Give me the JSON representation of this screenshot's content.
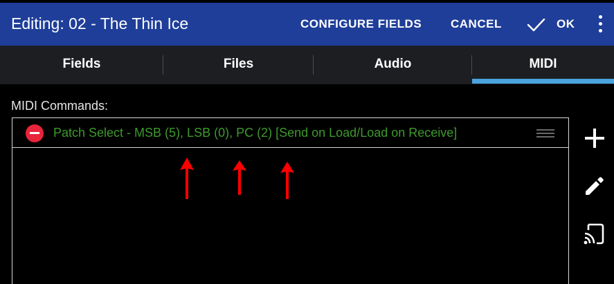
{
  "header": {
    "title": "Editing: 02 - The Thin Ice",
    "configure_label": "CONFIGURE FIELDS",
    "cancel_label": "CANCEL",
    "ok_label": "OK",
    "background_color": "#1f3e99"
  },
  "tabs": [
    {
      "label": "Fields",
      "active": false
    },
    {
      "label": "Files",
      "active": false
    },
    {
      "label": "Audio",
      "active": false
    },
    {
      "label": "MIDI",
      "active": true
    }
  ],
  "tab_indicator_color": "#4aa3de",
  "midi": {
    "section_label": "MIDI Commands:",
    "commands": [
      {
        "text": "Patch Select - MSB (5), LSB (0), PC (2) [Send on Load/Load on Receive]",
        "color": "#3d9a2c"
      }
    ]
  },
  "side_actions": [
    {
      "icon": "plus-icon"
    },
    {
      "icon": "pencil-icon"
    },
    {
      "icon": "cast-icon"
    }
  ],
  "annotations": {
    "arrow_color": "#ff0000"
  }
}
